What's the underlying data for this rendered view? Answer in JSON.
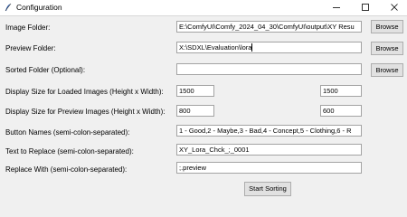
{
  "window": {
    "title": "Configuration"
  },
  "form": {
    "image_folder": {
      "label": "Image Folder:",
      "value": "E:\\ComfyUI\\Comfy_2024_04_30\\ComfyUI\\output\\XY Resu"
    },
    "preview_folder": {
      "label": "Preview Folder:",
      "value": "X:\\SDXL\\Evaluation\\lora"
    },
    "sorted_folder": {
      "label": "Sorted Folder (Optional):",
      "value": ""
    },
    "loaded_size": {
      "label": "Display Size for Loaded Images (Height x Width):",
      "height": "1500",
      "width": "1500"
    },
    "preview_size": {
      "label": "Display Size for Preview Images (Height x Width):",
      "height": "800",
      "width": "600"
    },
    "button_names": {
      "label": "Button Names (semi-colon-separated):",
      "value": "1 - Good,2 - Maybe,3 - Bad,4 - Concept,5 - Clothing,6 - R"
    },
    "text_to_replace": {
      "label": "Text to Replace (semi-colon-separated):",
      "value": "XY_Lora_Chck_;_0001"
    },
    "replace_with": {
      "label": "Replace With (semi-colon-separated):",
      "value": ";.preview"
    }
  },
  "buttons": {
    "browse": "Browse",
    "start": "Start Sorting"
  }
}
